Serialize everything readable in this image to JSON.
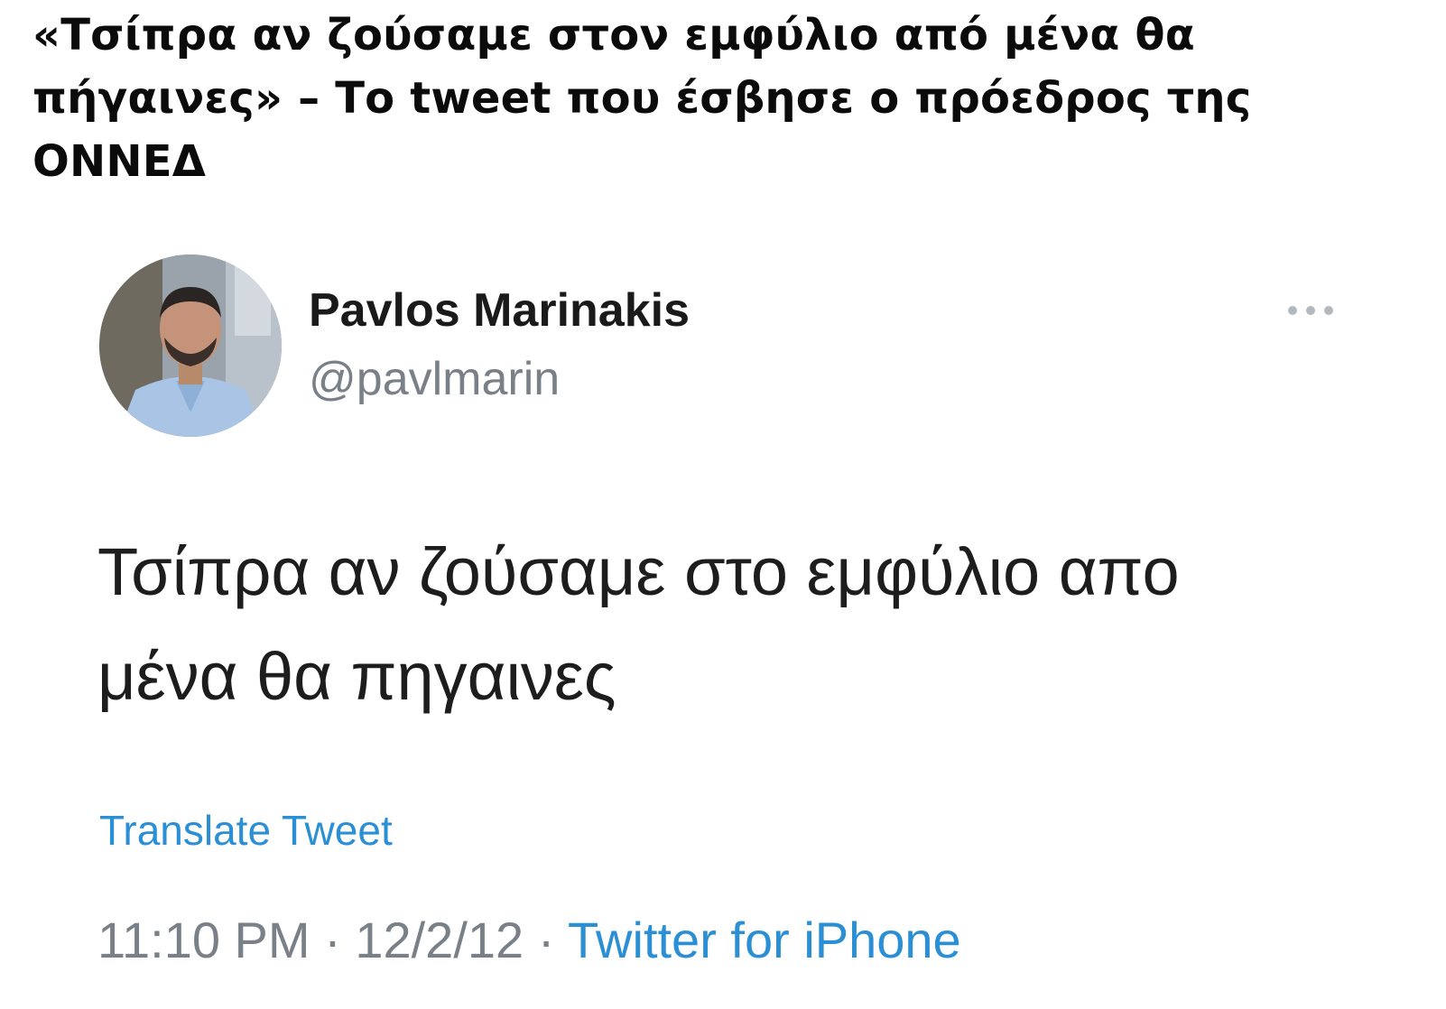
{
  "headline": "«Τσίπρα αν ζούσαμε στον εμφύλιο από μένα θα πήγαινες» – Το tweet που έσβησε ο πρόεδρος της ΟΝΝΕΔ",
  "tweet": {
    "author_name": "Pavlos Marinakis",
    "author_handle": "@pavlmarin",
    "more_icon": "more-horizontal-icon",
    "text_line1": "Τσίπρα αν ζούσαμε στο εμφύλιο απο",
    "text_line2": "μένα θα πηγαινες",
    "translate_label": "Translate Tweet",
    "time": "11:10 PM",
    "separator": "·",
    "date": "12/2/12",
    "source": "Twitter for iPhone"
  },
  "colors": {
    "link": "#2a8fd4",
    "muted": "#7a8087",
    "text": "#1d1d1d"
  }
}
